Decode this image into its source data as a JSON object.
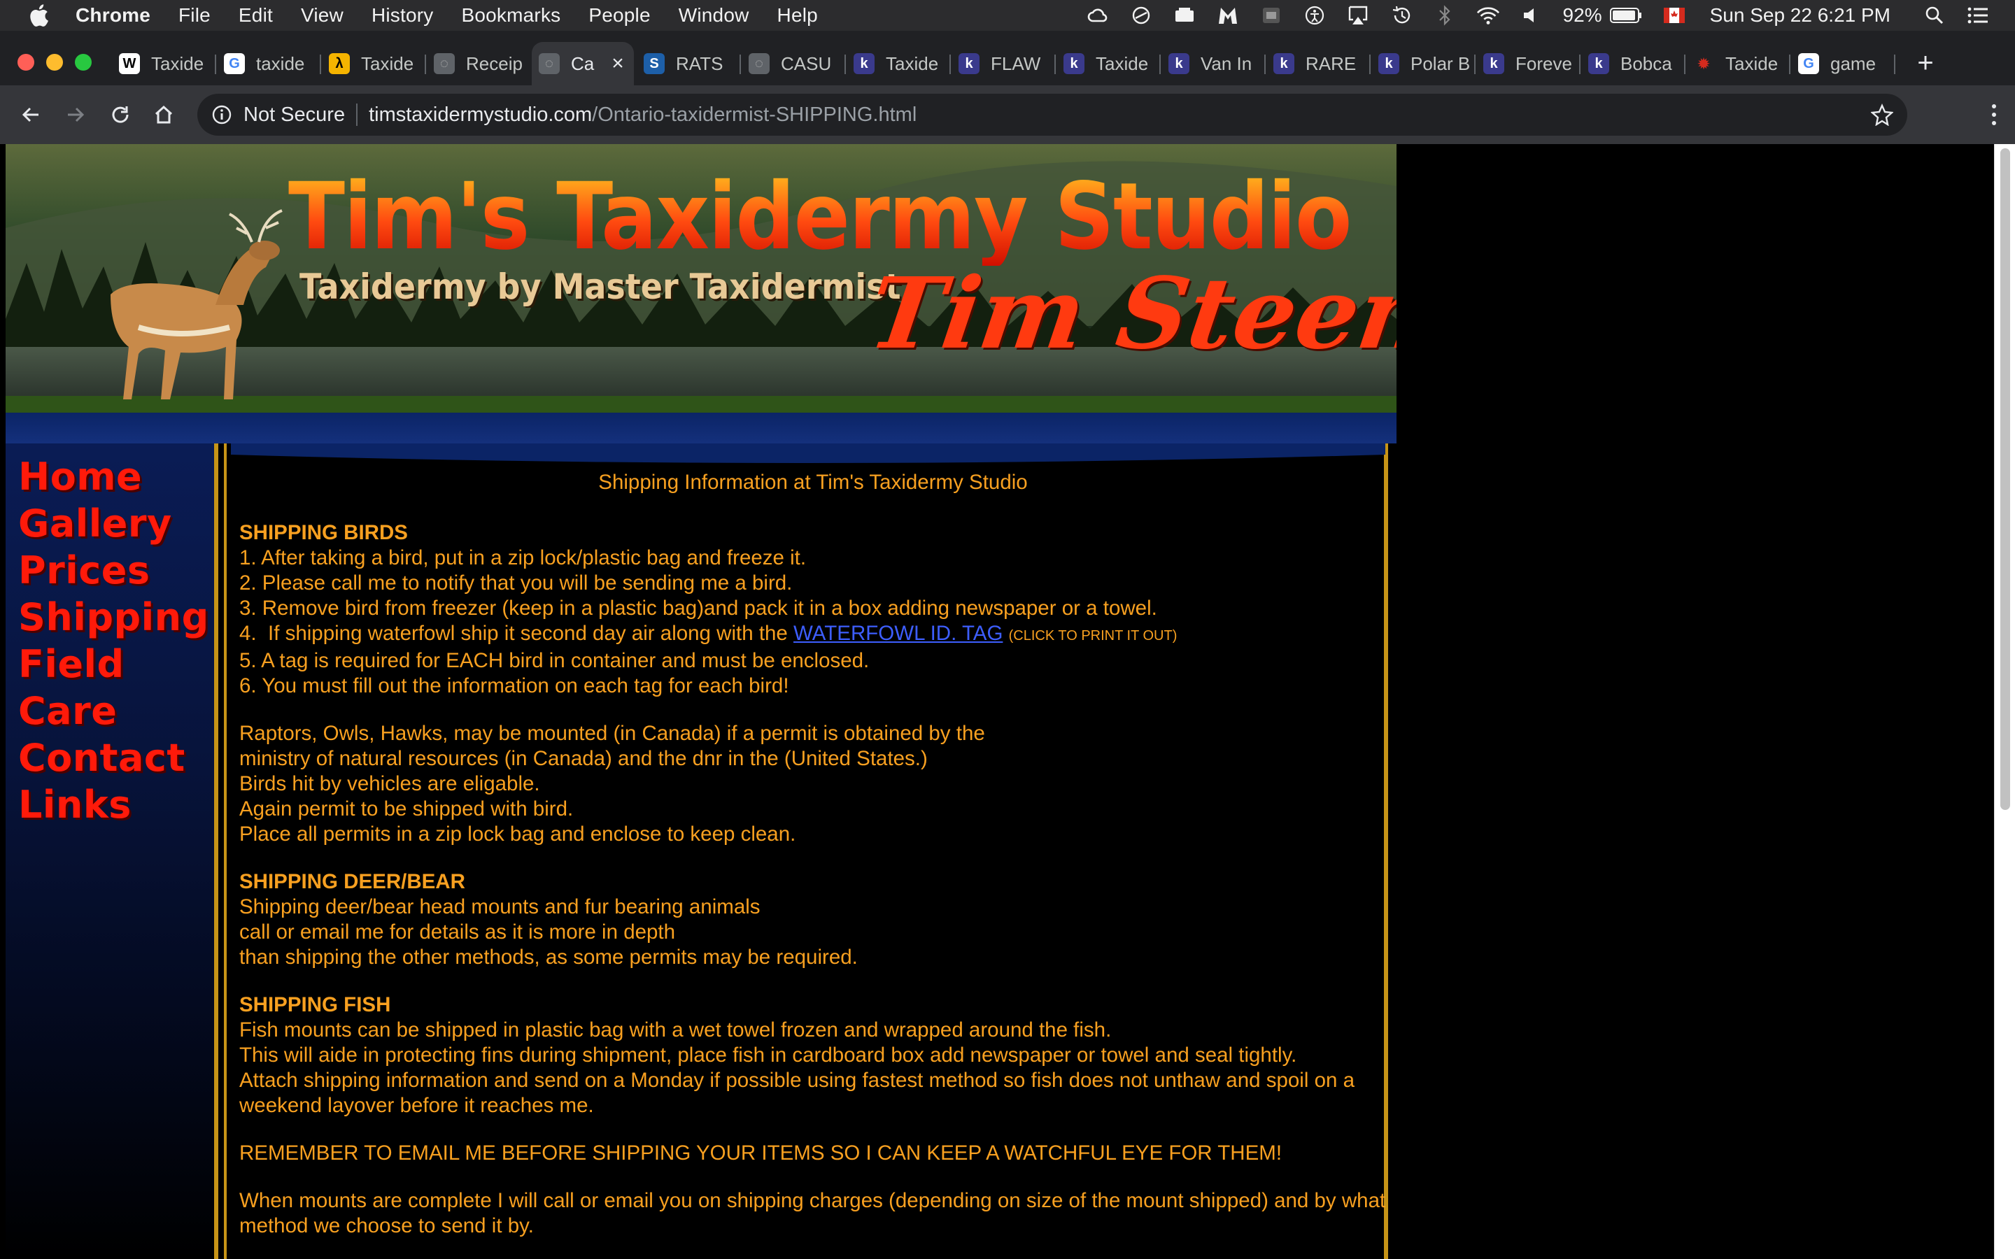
{
  "menubar": {
    "app_name": "Chrome",
    "menus": [
      "File",
      "Edit",
      "View",
      "History",
      "Bookmarks",
      "People",
      "Window",
      "Help"
    ],
    "status_icons": [
      "creative-cloud-icon",
      "sync-icon",
      "drive-icon",
      "malwarebytes-icon",
      "screen-icon",
      "accessibility-icon",
      "airplay-icon",
      "time-machine-icon",
      "bluetooth-icon",
      "wifi-icon",
      "volume-icon"
    ],
    "battery_percent": "92%",
    "flag": "canada-flag-icon",
    "clock": "Sun Sep 22  6:21 PM"
  },
  "tabs": [
    {
      "label": "Taxide",
      "icon": "wikipedia-icon",
      "active": false
    },
    {
      "label": "taxide",
      "icon": "google-icon",
      "active": false
    },
    {
      "label": "Taxide",
      "icon": "yellow-favicon",
      "active": false
    },
    {
      "label": "Receip",
      "icon": "globe-icon",
      "active": false
    },
    {
      "label": "Ca",
      "icon": "globe-icon",
      "active": true
    },
    {
      "label": "RATS",
      "icon": "spec-icon",
      "active": false
    },
    {
      "label": "CASU",
      "icon": "globe-icon",
      "active": false
    },
    {
      "label": "Taxide",
      "icon": "kijiji-icon",
      "active": false
    },
    {
      "label": "FLAW",
      "icon": "kijiji-icon",
      "active": false
    },
    {
      "label": "Taxide",
      "icon": "kijiji-icon",
      "active": false
    },
    {
      "label": "Van In",
      "icon": "kijiji-icon",
      "active": false
    },
    {
      "label": "RARE",
      "icon": "kijiji-icon",
      "active": false
    },
    {
      "label": "Polar B",
      "icon": "kijiji-icon",
      "active": false
    },
    {
      "label": "Foreve",
      "icon": "kijiji-icon",
      "active": false
    },
    {
      "label": "Bobca",
      "icon": "kijiji-icon",
      "active": false
    },
    {
      "label": "Taxide",
      "icon": "maple-leaf-icon",
      "active": false
    },
    {
      "label": "game",
      "icon": "google-icon",
      "active": false
    }
  ],
  "toolbar": {
    "security_label": "Not Secure",
    "url_host": "timstaxidermystudio.com",
    "url_path": "/Ontario-taxidermist-SHIPPING.html"
  },
  "banner": {
    "title": "Tim's Taxidermy Studio",
    "subtitle": "Taxidermy by Master Taxidermist",
    "signature": "Tim Steen"
  },
  "nav": [
    "Home",
    "Gallery",
    "Prices",
    "Shipping",
    "Field Care",
    "Contact",
    "Links"
  ],
  "content": {
    "page_title": "Shipping Information at Tim's Taxidermy Studio",
    "birds_heading": "SHIPPING BIRDS",
    "bird_steps": [
      "1.  After taking a bird, put in a zip lock/plastic bag and freeze it.",
      "2.  Please call me to notify that you will be sending me a bird.",
      "3.  Remove bird from freezer (keep in a plastic bag)and pack it in a box adding newspaper or a towel.",
      "4.  If shipping waterfowl ship it second day air along with the ",
      "5.  A tag is required for EACH bird in container and must be enclosed.",
      "6.  You must fill out the information on each tag for each bird!"
    ],
    "waterfowl_link": "WATERFOWL ID. TAG",
    "waterfowl_note": "(CLICK TO PRINT IT OUT)",
    "raptors_lines": [
      "Raptors, Owls, Hawks, may be mounted (in Canada) if a permit is obtained by the",
      "ministry of natural resources (in Canada) and the dnr in the (United States.)",
      "Birds hit by vehicles are eligable.",
      "Again permit to be shipped with bird.",
      "Place all permits in a zip lock bag and enclose to keep clean."
    ],
    "deer_heading": "SHIPPING DEER/BEAR",
    "deer_lines": [
      "Shipping deer/bear head mounts and fur bearing animals",
      "call or email me for details as it is more in depth",
      "than shipping the other methods, as some permits may be required."
    ],
    "fish_heading": "SHIPPING FISH",
    "fish_lines": [
      "Fish mounts can be shipped in plastic bag with a wet towel frozen and wrapped around the fish.",
      "This will aide in protecting fins during shipment, place fish in cardboard box add newspaper or towel and seal tightly.",
      "Attach shipping information and send on a Monday if possible using fastest method so fish does not unthaw and spoil on a weekend layover before it reaches me."
    ],
    "reminder": "REMEMBER TO EMAIL ME BEFORE SHIPPING YOUR ITEMS SO I CAN KEEP A WATCHFUL EYE FOR THEM!",
    "completion": "When mounts are complete I will call or email you on shipping charges (depending on size of the mount shipped) and by what method we choose to send it by."
  },
  "colors": {
    "text_orange": "#f8a020",
    "nav_red": "#ff1a0a",
    "link_blue": "#3d5eff",
    "gold_rule": "#c79417",
    "navy": "#0b2466"
  }
}
